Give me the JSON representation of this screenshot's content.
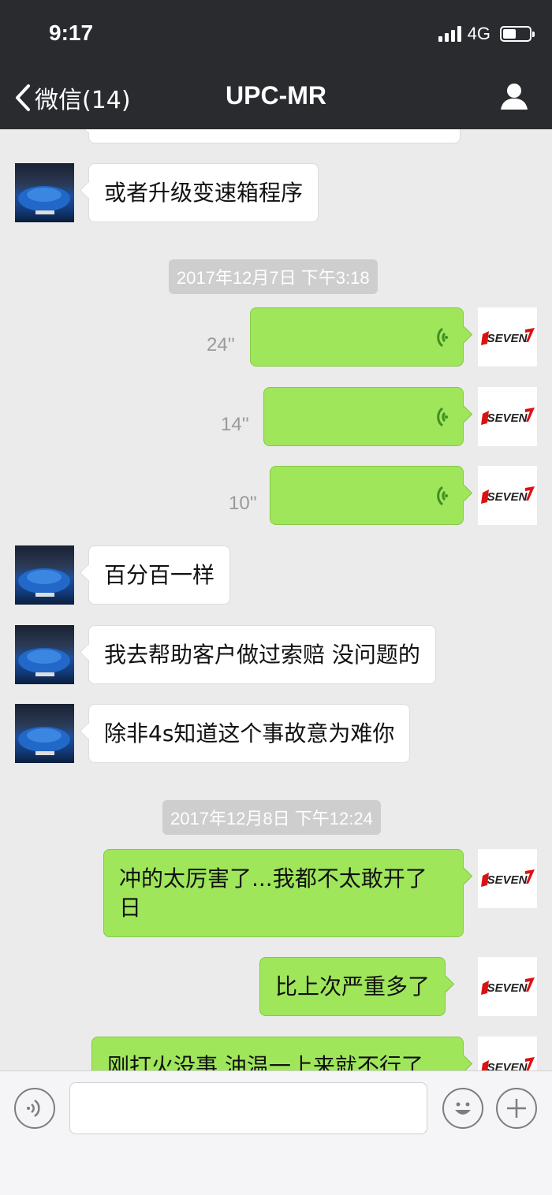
{
  "status_bar": {
    "time": "9:17",
    "network": "4G",
    "battery_level": 0.5
  },
  "nav": {
    "back_label": "微信(14)",
    "title": "UPC-MR"
  },
  "timestamps": [
    "2017年12月7日 下午3:18",
    "2017年12月8日 下午12:24"
  ],
  "messages": {
    "m1": "或者升级变速箱程序",
    "v1": "24''",
    "v2": "14''",
    "v3": "10''",
    "m2": "百分百一样",
    "m3": "我去帮助客户做过索赔 没问题的",
    "m4": "除非4s知道这个事故意为难你",
    "m5": "冲的太厉害了...我都不太敢开了日",
    "m6": "比上次严重多了",
    "m7": "刚打火没事 油温一上来就不行了"
  },
  "avatars": {
    "contact": "car-avatar",
    "self": "SEVEN"
  },
  "input_bar": {
    "voice_icon": "voice-icon",
    "emoji_icon": "emoji-icon",
    "plus_icon": "plus-icon"
  },
  "colors": {
    "header": "#2a2b2f",
    "sent_bubble": "#9fe65b",
    "received_bubble": "#ffffff",
    "chat_bg": "#ebebeb"
  }
}
